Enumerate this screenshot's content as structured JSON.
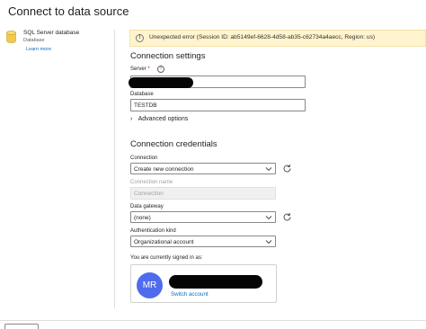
{
  "dialog": {
    "title": "Connect to data source"
  },
  "source": {
    "name": "SQL Server database",
    "type": "Database",
    "learn_more": "Learn more"
  },
  "banner": {
    "text": "Unexpected error (Session ID: ab5149ef-6628-4d58-ab35-c62734a4aecc, Region: us)"
  },
  "connection_settings": {
    "heading": "Connection settings",
    "server_label": "Server",
    "server_required_mark": "*",
    "database_label": "Database",
    "database_value": "TESTDB",
    "advanced_options": "Advanced options"
  },
  "credentials": {
    "heading": "Connection credentials",
    "connection_label": "Connection",
    "connection_value": "Create new connection",
    "connection_name_label": "Connection name",
    "connection_name_placeholder": "Connection",
    "gateway_label": "Data gateway",
    "gateway_value": "(none)",
    "auth_label": "Authentication kind",
    "auth_value": "Organizational account",
    "signed_in_label": "You are currently signed in as:",
    "avatar_initials": "MR",
    "switch_account": "Switch account"
  },
  "colors": {
    "accent": "#0f6cbd",
    "avatar": "#4f6bed",
    "warning_bg": "#fff4ce"
  }
}
